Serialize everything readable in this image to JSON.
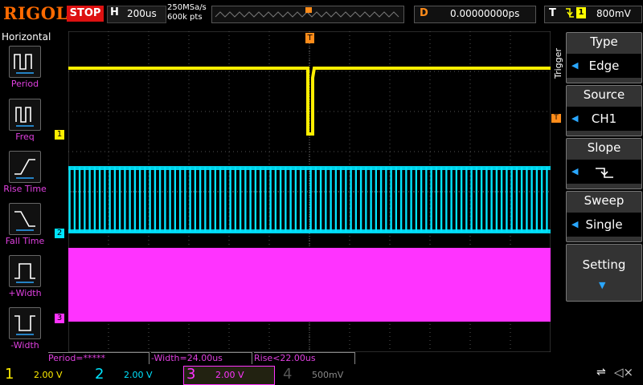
{
  "header": {
    "brand": "RIGOL",
    "run_state": "STOP",
    "timebase_label": "H",
    "timebase_value": "200us",
    "sample_rate": "250MSa/s",
    "memory_depth": "600k pts",
    "delay_label": "D",
    "delay_value": "0.00000000ps",
    "trigger_label": "T",
    "trigger_channel": "1",
    "trigger_level": "800mV"
  },
  "left_panel": {
    "title": "Horizontal",
    "items": [
      {
        "label": "Period",
        "icon": "period-icon"
      },
      {
        "label": "Freq",
        "icon": "frequency-icon"
      },
      {
        "label": "Rise Time",
        "icon": "rise-time-icon"
      },
      {
        "label": "Fall Time",
        "icon": "fall-time-icon"
      },
      {
        "label": "+Width",
        "icon": "positive-width-icon"
      },
      {
        "label": "-Width",
        "icon": "negative-width-icon"
      }
    ]
  },
  "right_panel": {
    "tab": "Trigger",
    "items": [
      {
        "title": "Type",
        "value": "Edge"
      },
      {
        "title": "Source",
        "value": "CH1"
      },
      {
        "title": "Slope",
        "value": ""
      },
      {
        "title": "Sweep",
        "value": "Single"
      },
      {
        "title": "Setting",
        "value": ""
      }
    ]
  },
  "markers": {
    "ch1": "1",
    "ch2": "2",
    "ch3": "3",
    "trigger_top": "T",
    "trigger_right": "T"
  },
  "measurements": [
    "Period=*****",
    "-Width=24.00us",
    "Rise<22.00us"
  ],
  "channels": [
    {
      "num": "1",
      "scale": "2.00 V",
      "color": "#ffee00"
    },
    {
      "num": "2",
      "scale": "2.00 V",
      "color": "#00e5ff"
    },
    {
      "num": "3",
      "scale": "2.00 V",
      "color": "#ff33ff"
    },
    {
      "num": "4",
      "scale": "500mV",
      "color": "#555555"
    }
  ],
  "colors": {
    "ch1": "#ffee00",
    "ch2": "#00e5ff",
    "ch3": "#ff33ff",
    "accent": "#ff8c1a",
    "panel_blue": "#2aa7ff"
  }
}
